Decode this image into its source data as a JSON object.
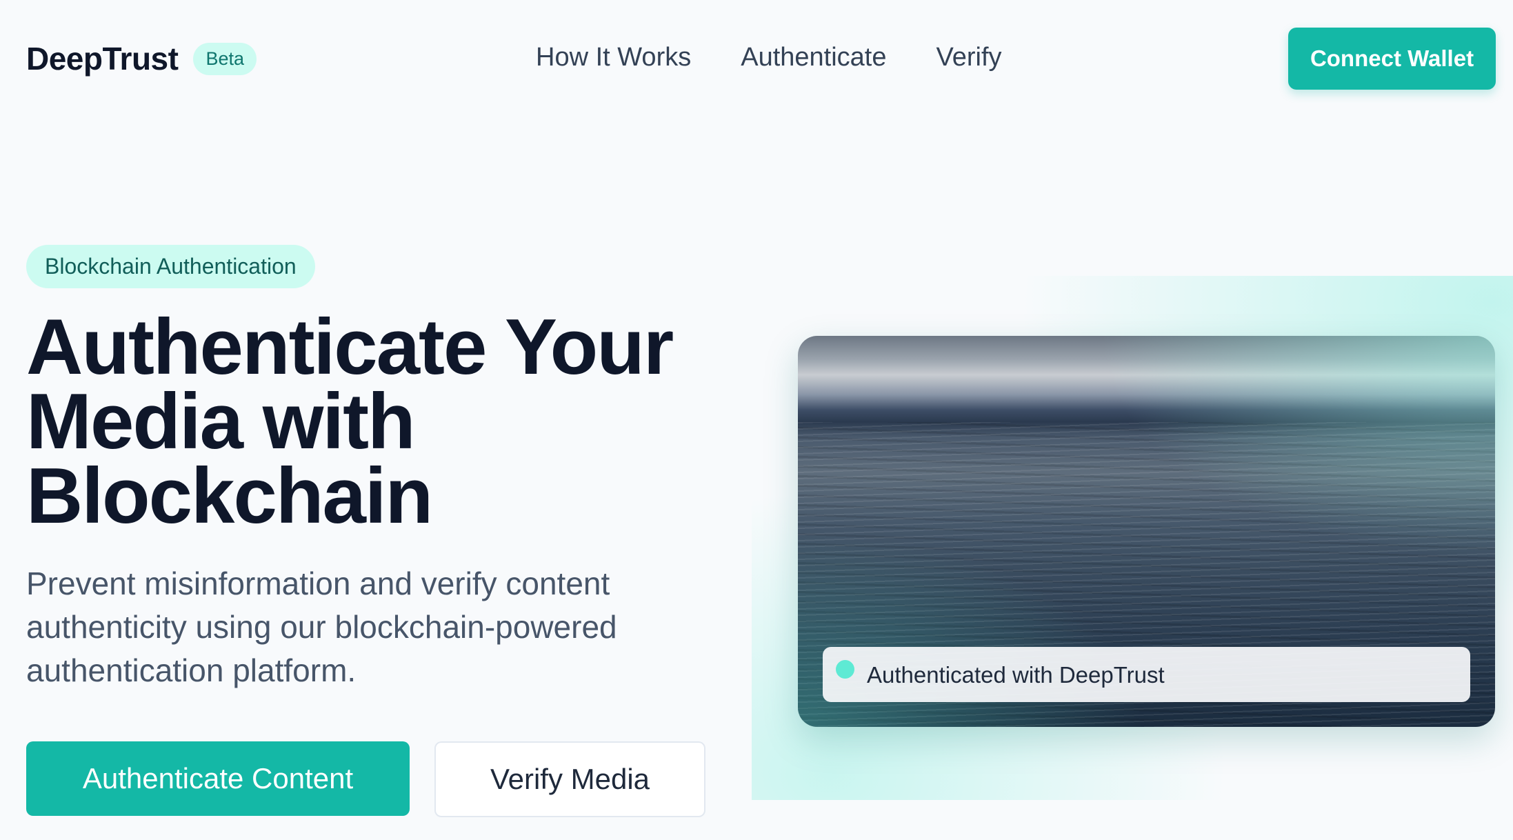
{
  "header": {
    "brand": "DeepTrust",
    "badge": "Beta",
    "nav": [
      {
        "label": "How It Works"
      },
      {
        "label": "Authenticate"
      },
      {
        "label": "Verify"
      }
    ],
    "connect_label": "Connect Wallet"
  },
  "hero": {
    "pill": "Blockchain Authentication",
    "title": "Authenticate Your Media with Blockchain",
    "subtitle": "Prevent misinformation and verify content authenticity using our blockchain-powered authentication platform.",
    "primary_cta": "Authenticate Content",
    "secondary_cta": "Verify Media"
  },
  "media": {
    "status_text": "Authenticated with DeepTrust",
    "status_dot_icon": "status-dot"
  },
  "colors": {
    "accent": "#14b8a6",
    "accent_light": "#ccfbf1",
    "text_dark": "#0f172a",
    "text_muted": "#475569",
    "background": "#f8fafc"
  }
}
